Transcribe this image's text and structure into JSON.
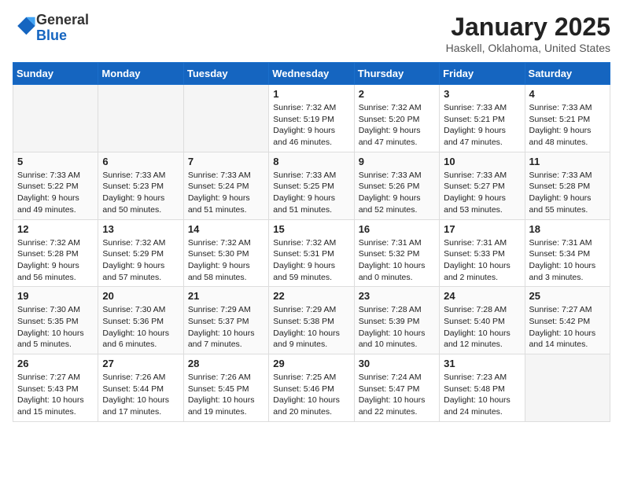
{
  "header": {
    "logo_general": "General",
    "logo_blue": "Blue",
    "month_title": "January 2025",
    "location": "Haskell, Oklahoma, United States"
  },
  "weekdays": [
    "Sunday",
    "Monday",
    "Tuesday",
    "Wednesday",
    "Thursday",
    "Friday",
    "Saturday"
  ],
  "weeks": [
    [
      {
        "day": "",
        "empty": true
      },
      {
        "day": "",
        "empty": true
      },
      {
        "day": "",
        "empty": true
      },
      {
        "day": "1",
        "sunrise": "7:32 AM",
        "sunset": "5:19 PM",
        "daylight": "9 hours and 46 minutes."
      },
      {
        "day": "2",
        "sunrise": "7:32 AM",
        "sunset": "5:20 PM",
        "daylight": "9 hours and 47 minutes."
      },
      {
        "day": "3",
        "sunrise": "7:33 AM",
        "sunset": "5:21 PM",
        "daylight": "9 hours and 47 minutes."
      },
      {
        "day": "4",
        "sunrise": "7:33 AM",
        "sunset": "5:21 PM",
        "daylight": "9 hours and 48 minutes."
      }
    ],
    [
      {
        "day": "5",
        "sunrise": "7:33 AM",
        "sunset": "5:22 PM",
        "daylight": "9 hours and 49 minutes."
      },
      {
        "day": "6",
        "sunrise": "7:33 AM",
        "sunset": "5:23 PM",
        "daylight": "9 hours and 50 minutes."
      },
      {
        "day": "7",
        "sunrise": "7:33 AM",
        "sunset": "5:24 PM",
        "daylight": "9 hours and 51 minutes."
      },
      {
        "day": "8",
        "sunrise": "7:33 AM",
        "sunset": "5:25 PM",
        "daylight": "9 hours and 51 minutes."
      },
      {
        "day": "9",
        "sunrise": "7:33 AM",
        "sunset": "5:26 PM",
        "daylight": "9 hours and 52 minutes."
      },
      {
        "day": "10",
        "sunrise": "7:33 AM",
        "sunset": "5:27 PM",
        "daylight": "9 hours and 53 minutes."
      },
      {
        "day": "11",
        "sunrise": "7:33 AM",
        "sunset": "5:28 PM",
        "daylight": "9 hours and 55 minutes."
      }
    ],
    [
      {
        "day": "12",
        "sunrise": "7:32 AM",
        "sunset": "5:28 PM",
        "daylight": "9 hours and 56 minutes."
      },
      {
        "day": "13",
        "sunrise": "7:32 AM",
        "sunset": "5:29 PM",
        "daylight": "9 hours and 57 minutes."
      },
      {
        "day": "14",
        "sunrise": "7:32 AM",
        "sunset": "5:30 PM",
        "daylight": "9 hours and 58 minutes."
      },
      {
        "day": "15",
        "sunrise": "7:32 AM",
        "sunset": "5:31 PM",
        "daylight": "9 hours and 59 minutes."
      },
      {
        "day": "16",
        "sunrise": "7:31 AM",
        "sunset": "5:32 PM",
        "daylight": "10 hours and 0 minutes."
      },
      {
        "day": "17",
        "sunrise": "7:31 AM",
        "sunset": "5:33 PM",
        "daylight": "10 hours and 2 minutes."
      },
      {
        "day": "18",
        "sunrise": "7:31 AM",
        "sunset": "5:34 PM",
        "daylight": "10 hours and 3 minutes."
      }
    ],
    [
      {
        "day": "19",
        "sunrise": "7:30 AM",
        "sunset": "5:35 PM",
        "daylight": "10 hours and 5 minutes."
      },
      {
        "day": "20",
        "sunrise": "7:30 AM",
        "sunset": "5:36 PM",
        "daylight": "10 hours and 6 minutes."
      },
      {
        "day": "21",
        "sunrise": "7:29 AM",
        "sunset": "5:37 PM",
        "daylight": "10 hours and 7 minutes."
      },
      {
        "day": "22",
        "sunrise": "7:29 AM",
        "sunset": "5:38 PM",
        "daylight": "10 hours and 9 minutes."
      },
      {
        "day": "23",
        "sunrise": "7:28 AM",
        "sunset": "5:39 PM",
        "daylight": "10 hours and 10 minutes."
      },
      {
        "day": "24",
        "sunrise": "7:28 AM",
        "sunset": "5:40 PM",
        "daylight": "10 hours and 12 minutes."
      },
      {
        "day": "25",
        "sunrise": "7:27 AM",
        "sunset": "5:42 PM",
        "daylight": "10 hours and 14 minutes."
      }
    ],
    [
      {
        "day": "26",
        "sunrise": "7:27 AM",
        "sunset": "5:43 PM",
        "daylight": "10 hours and 15 minutes."
      },
      {
        "day": "27",
        "sunrise": "7:26 AM",
        "sunset": "5:44 PM",
        "daylight": "10 hours and 17 minutes."
      },
      {
        "day": "28",
        "sunrise": "7:26 AM",
        "sunset": "5:45 PM",
        "daylight": "10 hours and 19 minutes."
      },
      {
        "day": "29",
        "sunrise": "7:25 AM",
        "sunset": "5:46 PM",
        "daylight": "10 hours and 20 minutes."
      },
      {
        "day": "30",
        "sunrise": "7:24 AM",
        "sunset": "5:47 PM",
        "daylight": "10 hours and 22 minutes."
      },
      {
        "day": "31",
        "sunrise": "7:23 AM",
        "sunset": "5:48 PM",
        "daylight": "10 hours and 24 minutes."
      },
      {
        "day": "",
        "empty": true
      }
    ]
  ]
}
